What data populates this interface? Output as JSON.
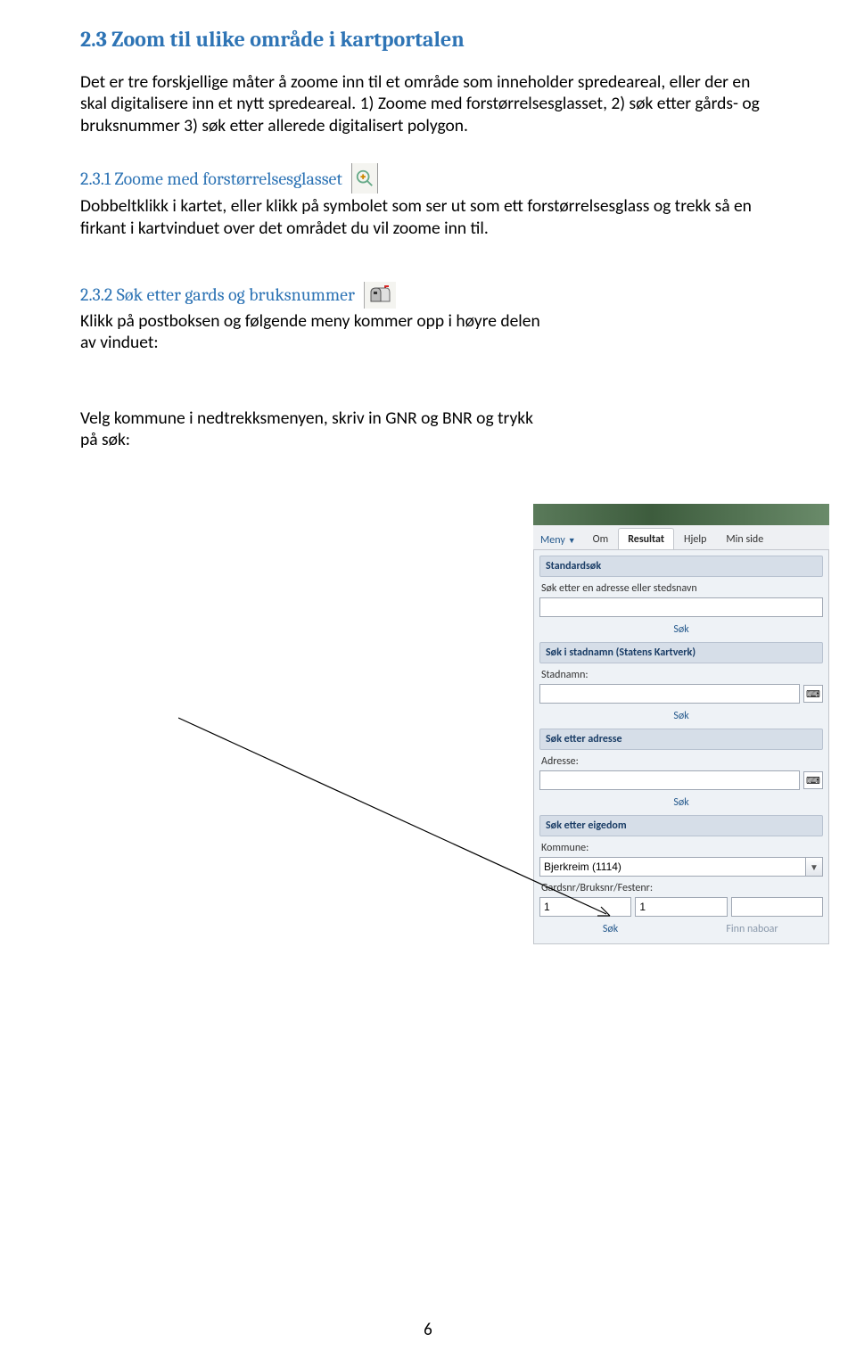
{
  "section": {
    "title": "2.3 Zoom til ulike område i kartportalen",
    "intro": "Det er tre forskjellige måter å zoome inn til et område som inneholder spredeareal, eller der en skal digitalisere inn et nytt spredeareal. 1) Zoome med forstørrelsesglasset, 2) søk etter gårds- og bruksnummer 3) søk etter allerede digitalisert polygon."
  },
  "sub1": {
    "title": "2.3.1 Zoome med forstørrelsesglasset",
    "body": "Dobbeltklikk i kartet, eller klikk på symbolet som ser ut som ett forstørrelsesglass og trekk så en firkant i kartvinduet over det området du vil zoome inn til."
  },
  "sub2": {
    "title": "2.3.2 Søk etter gards og bruksnummer",
    "body1": "Klikk på postboksen og følgende meny kommer opp i høyre delen av vinduet:",
    "body2": "Velg kommune i nedtrekksmenyen, skriv in GNR og BNR og trykk på søk:"
  },
  "sidebar": {
    "menu": "Meny",
    "tabs": {
      "om": "Om",
      "resultat": "Resultat",
      "hjelp": "Hjelp",
      "minside": "Min side"
    },
    "std_head": "Standardsøk",
    "std_label": "Søk etter en adresse eller stedsnavn",
    "sok": "Søk",
    "stad_head": "Søk i stadnamn (Statens Kartverk)",
    "stad_label": "Stadnamn:",
    "adr_head": "Søk etter adresse",
    "adr_label": "Adresse:",
    "eig_head": "Søk etter eigedom",
    "kommune_label": "Kommune:",
    "kommune_value": "Bjerkreim (1114)",
    "gbf_label": "Gardsnr/Bruksnr/Festenr:",
    "gbf1": "1",
    "gbf2": "1",
    "gbf3": "",
    "finn": "Finn naboar"
  },
  "page_number": "6"
}
